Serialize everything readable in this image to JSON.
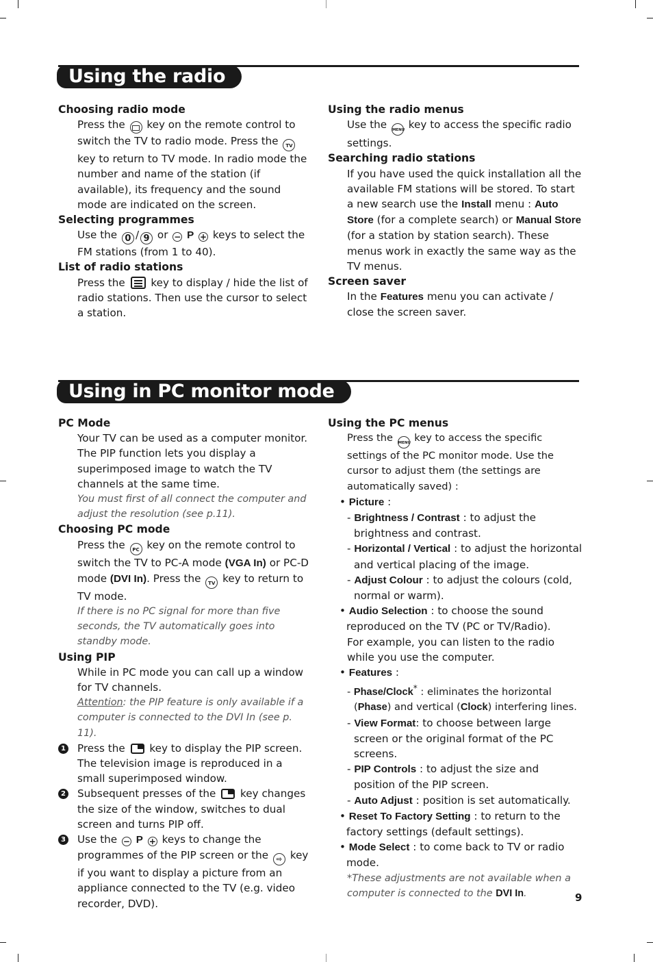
{
  "sections": {
    "radio": {
      "title": "Using the radio",
      "left": [
        {
          "heading": "Choosing radio mode",
          "p1a": "Press the",
          "icon1": "radio-key-icon",
          "p1b": "key on the remote control to switch the TV to radio mode.  Press the",
          "icon2_label": "TV",
          "p1c": "key to return to TV mode.  In radio mode the number and name of the station (if available), its frequency and the sound mode are indicated on the screen."
        },
        {
          "heading": "Selecting programmes",
          "p1a": "Use the",
          "key0": "0",
          "slash": "/",
          "key9": "9",
          "or": "or",
          "minus": "−",
          "P": "P",
          "plus": "+",
          "p1b": "keys to select the FM stations (from 1 to 40)."
        },
        {
          "heading": "List of radio stations",
          "p1a": "Press the",
          "p1b": "key to display / hide the list of radio stations. Then use the cursor to select a station."
        }
      ],
      "right": [
        {
          "heading": "Using the radio menus",
          "p1a": "Use the",
          "menu_label": "MENU",
          "p1b": "key to access the specific radio settings."
        },
        {
          "heading": "Searching radio stations",
          "p1a": "If you have used the quick installation all the available FM stations will be stored.  To start a new search use the",
          "b1": "Install",
          "p1b": "menu :",
          "b2": "Auto Store",
          "p1c": "(for a complete search) or",
          "b3": "Manual Store",
          "p1d": "(for a station by station search). These menus work in exactly the same way as the TV menus."
        },
        {
          "heading": "Screen saver",
          "p1a": "In the",
          "b1": "Features",
          "p1b": "menu you can activate / close the screen saver."
        }
      ]
    },
    "pc": {
      "title": "Using in PC monitor mode",
      "left": {
        "pc_mode": {
          "heading": "PC Mode",
          "p1": "Your TV can be used as a computer monitor. The PIP function lets you display a superimposed image to watch the TV channels at the same time.",
          "note": "You must first of all connect the computer and adjust the resolution (see p.11)."
        },
        "choosing": {
          "heading": "Choosing PC mode",
          "p1a": "Press the",
          "pc_label": "PC",
          "p1b": "key on the remote control to switch the TV to PC-A mode",
          "b1": "(VGA In)",
          "p1c": "or PC-D mode",
          "b2": "(DVI In)",
          "p1d": ". Press the",
          "tv_label": "TV",
          "p1e": "key to return to TV mode.",
          "note": "If there is no PC signal for more than five seconds, the TV automatically goes into standby mode."
        },
        "pip": {
          "heading": "Using PIP",
          "p1": "While in PC mode you can call up a window for TV channels.",
          "attention": "Attention",
          "note": ": the PIP feature is only available if a computer is connected to the DVI In (see p. 11).",
          "steps": [
            {
              "n": "1",
              "a": "Press the",
              "b": "key to display the PIP screen. The television image is reproduced in a small superimposed window."
            },
            {
              "n": "2",
              "a": "Subsequent presses of the",
              "b": "key changes the size of the window, switches to dual screen and turns PIP off."
            },
            {
              "n": "3",
              "a": "Use the",
              "minus": "−",
              "P": "P",
              "plus": "+",
              "b": "keys to change the programmes of the PIP screen or the",
              "c": "key if you want to display a picture from an appliance connected to the TV (e.g. video recorder, DVD)."
            }
          ]
        }
      },
      "right": {
        "heading": "Using the PC menus",
        "p1a": "Press the",
        "menu_label": "MENU",
        "p1b": "key to access the specific settings of the PC monitor mode.  Use the cursor to adjust them (the settings are automatically saved) :",
        "picture": {
          "label": "Picture",
          "suffix": " :",
          "items": [
            {
              "label": "Brightness / Contrast",
              "text": " : to adjust the brightness and contrast."
            },
            {
              "label": "Horizontal / Vertical",
              "text": " : to adjust the horizontal and vertical placing of the image."
            },
            {
              "label": "Adjust Colour",
              "text": " : to adjust the colours (cold, normal or warm)."
            }
          ]
        },
        "audio": {
          "label": "Audio Selection",
          "text": " : to choose the sound reproduced on the TV (PC or TV/Radio).",
          "extra": "For example, you can listen to the radio while you use the computer."
        },
        "features": {
          "label": "Features",
          "suffix": " :",
          "items": [
            {
              "label": "Phase/Clock",
              "star": "*",
              "text": " : eliminates the horizontal (",
              "b1": "Phase",
              "t2": ") and vertical (",
              "b2": "Clock",
              "t3": ") interfering lines."
            },
            {
              "label": "View Format",
              "text": ": to choose between large screen or the original format of the PC screens."
            },
            {
              "label": "PIP Controls",
              "text": " : to adjust the size and position of the PIP screen."
            },
            {
              "label": "Auto Adjust",
              "text": " : position is set automatically."
            }
          ]
        },
        "reset": {
          "label": "Reset To Factory Setting",
          "text": " : to return to the factory settings (default settings)."
        },
        "mode": {
          "label": "Mode Select",
          "text": " : to come back to TV or radio mode."
        },
        "footnote": {
          "a": "*These adjustments are not available when a computer is connected to the",
          "b": "DVI In",
          "c": "."
        }
      }
    }
  },
  "page_number": "9"
}
